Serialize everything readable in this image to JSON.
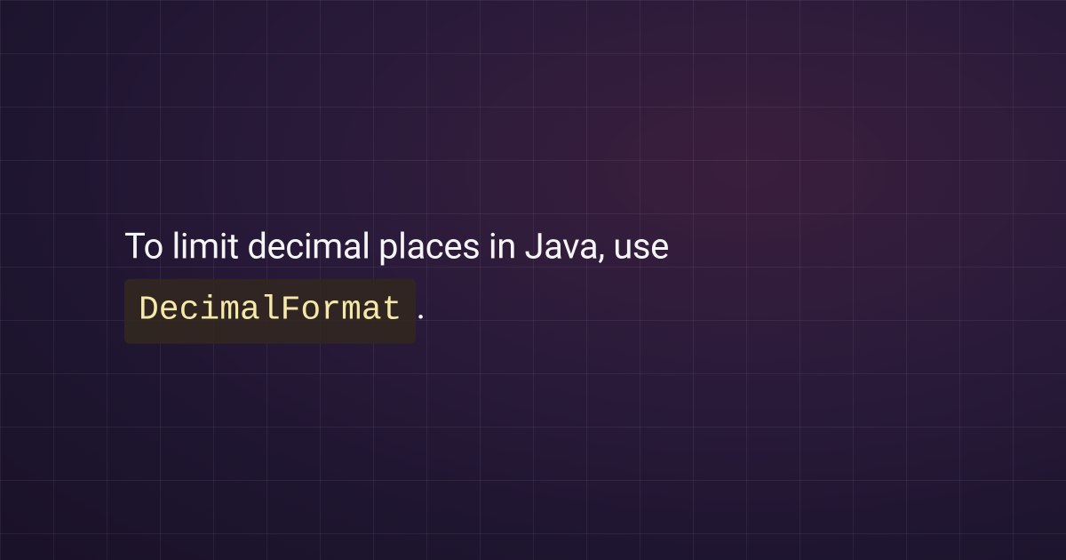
{
  "content": {
    "text_before": "To limit decimal places in Java, use ",
    "code_text": "DecimalFormat",
    "text_after": "."
  }
}
